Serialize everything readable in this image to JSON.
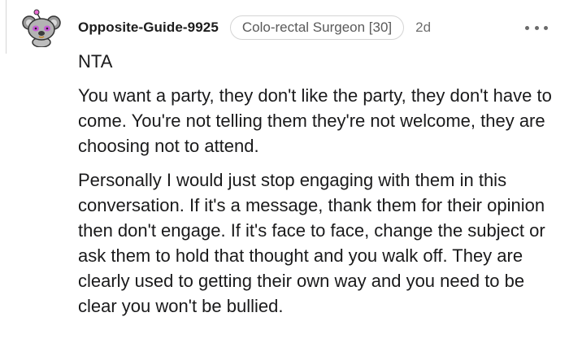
{
  "comment": {
    "author": "Opposite-Guide-9925",
    "flair": "Colo-rectal Surgeon [30]",
    "age": "2d",
    "icons": {
      "avatar": "koala-avatar-icon",
      "more": "more-options-icon"
    },
    "body": {
      "verdict": "NTA",
      "paragraph_1": "You want a party, they don't like the party, they don't have to come. You're not telling them they're not welcome, they are choosing not to attend.",
      "paragraph_2": "Personally I would just stop engaging with them in this conversation. If it's a message, thank them for their opinion then don't engage. If it's face to face, change the subject or ask them to hold that thought and you walk off. They are clearly used to getting their own way and you need to be clear you won't be bullied."
    }
  }
}
